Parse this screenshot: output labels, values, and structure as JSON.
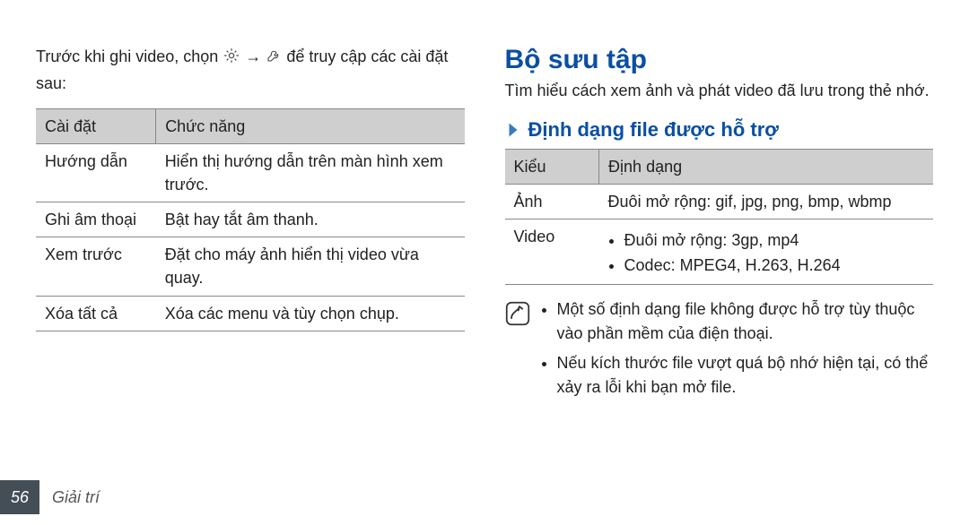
{
  "left": {
    "intro_pre": "Trước khi ghi video, chọn ",
    "intro_mid": " → ",
    "intro_post": " để truy cập các cài đặt sau:",
    "icon1_name": "gear-icon",
    "icon2_name": "wrench-icon",
    "table": {
      "header": {
        "c1": "Cài đặt",
        "c2": "Chức năng"
      },
      "rows": [
        {
          "c1": "Hướng dẫn",
          "c2": "Hiển thị hướng dẫn trên màn hình xem trước."
        },
        {
          "c1": "Ghi âm thoại",
          "c2": "Bật hay tắt âm thanh."
        },
        {
          "c1": "Xem trước",
          "c2": "Đặt cho máy ảnh hiển thị video vừa quay."
        },
        {
          "c1": "Xóa tất cả",
          "c2": "Xóa các menu và tùy chọn chụp."
        }
      ]
    }
  },
  "right": {
    "title": "Bộ sưu tập",
    "desc": "Tìm hiểu cách xem ảnh và phát video đã lưu trong thẻ nhớ.",
    "sub": "Định dạng file được hỗ trợ",
    "table": {
      "header": {
        "c1": "Kiểu",
        "c2": "Định dạng"
      },
      "rows": [
        {
          "c1": "Ảnh",
          "type": "text",
          "c2": "Đuôi mở rộng: gif, jpg, png, bmp, wbmp"
        },
        {
          "c1": "Video",
          "type": "list",
          "items": [
            "Đuôi mở rộng: 3gp, mp4",
            "Codec: MPEG4, H.263, H.264"
          ]
        }
      ]
    },
    "notes": [
      "Một số định dạng file không được hỗ trợ tùy thuộc vào phần mềm của điện thoại.",
      "Nếu kích thước file vượt quá bộ nhớ hiện tại, có thể xảy ra lỗi khi bạn mở file."
    ]
  },
  "footer": {
    "page": "56",
    "section": "Giải trí"
  }
}
